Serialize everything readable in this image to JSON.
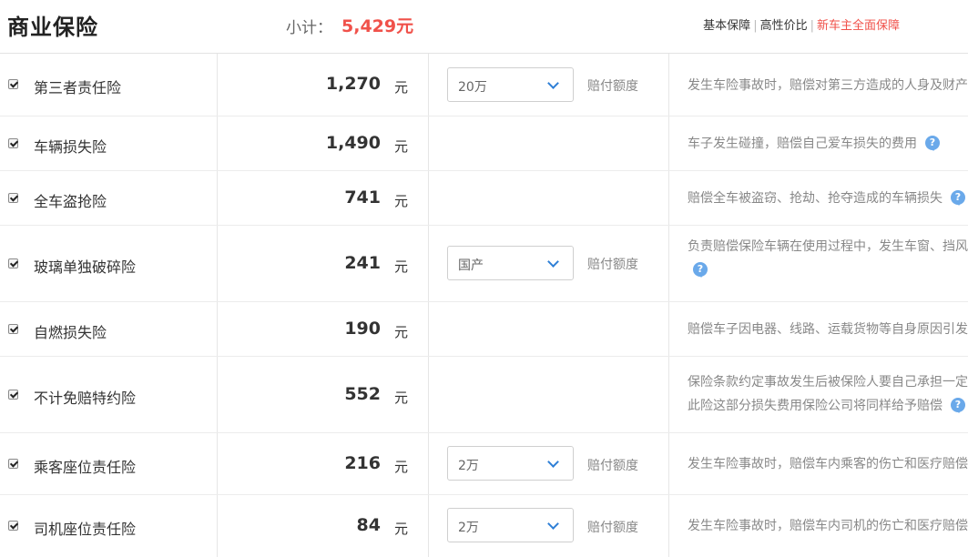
{
  "header": {
    "title": "商业保险",
    "subtotal_label": "小计：",
    "subtotal_value": "5,429元",
    "links": [
      "基本保障",
      "高性价比",
      "新车主全面保障"
    ],
    "active_link_color": "#f0514a"
  },
  "unit": "元",
  "payout_label": "赔付额度",
  "help_icon": "question-mark-icon",
  "accent_color": "#f0514a",
  "rows": [
    {
      "name": "第三者责任险",
      "price": "1,270",
      "select": "20万",
      "desc": [
        "发生车险事故时，赔偿对第三方造成的人身及财产"
      ],
      "help": false
    },
    {
      "name": "车辆损失险",
      "price": "1,490",
      "select": null,
      "desc": [
        "车子发生碰撞，赔偿自己爱车损失的费用"
      ],
      "help": true
    },
    {
      "name": "全车盗抢险",
      "price": "741",
      "select": null,
      "desc": [
        "赔偿全车被盗窃、抢劫、抢夺造成的车辆损失"
      ],
      "help": true
    },
    {
      "name": "玻璃单独破碎险",
      "price": "241",
      "select": "国产",
      "desc": [
        "负责赔偿保险车辆在使用过程中，发生车窗、挡风",
        ""
      ],
      "help": true
    },
    {
      "name": "自燃损失险",
      "price": "190",
      "select": null,
      "desc": [
        "赔偿车子因电器、线路、运载货物等自身原因引发"
      ],
      "help": false
    },
    {
      "name": "不计免赔特约险",
      "price": "552",
      "select": null,
      "desc": [
        "保险条款约定事故发生后被保险人要自己承担一定",
        "此险这部分损失费用保险公司将同样给予赔偿"
      ],
      "help": true
    },
    {
      "name": "乘客座位责任险",
      "price": "216",
      "select": "2万",
      "desc": [
        "发生车险事故时，赔偿车内乘客的伤亡和医疗赔偿"
      ],
      "help": false
    },
    {
      "name": "司机座位责任险",
      "price": "84",
      "select": "2万",
      "desc": [
        "发生车险事故时，赔偿车内司机的伤亡和医疗赔偿"
      ],
      "help": false
    }
  ]
}
